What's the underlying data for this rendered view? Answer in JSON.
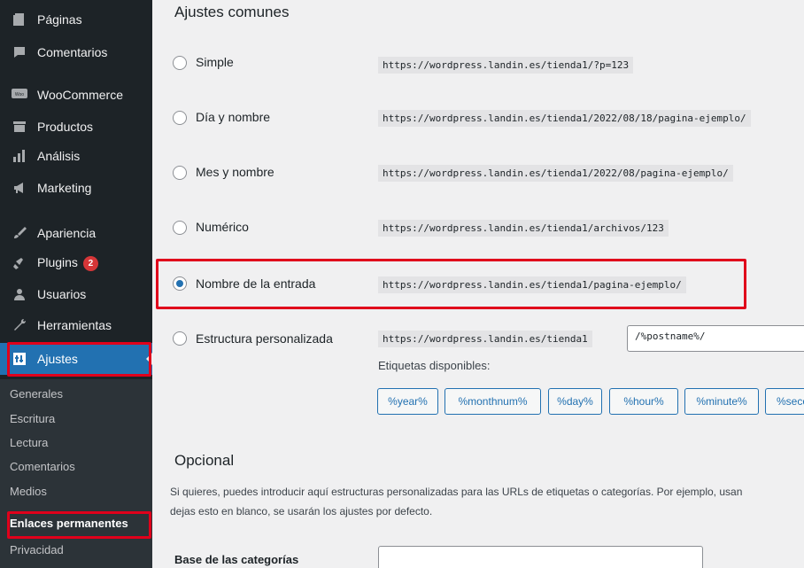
{
  "sidebar": {
    "items": [
      {
        "label": "Páginas",
        "icon": "pages-icon"
      },
      {
        "label": "Comentarios",
        "icon": "comments-icon"
      },
      {
        "label": "WooCommerce",
        "icon": "woocommerce-icon"
      },
      {
        "label": "Productos",
        "icon": "products-icon"
      },
      {
        "label": "Análisis",
        "icon": "analytics-icon"
      },
      {
        "label": "Marketing",
        "icon": "marketing-icon"
      },
      {
        "label": "Apariencia",
        "icon": "appearance-icon"
      },
      {
        "label": "Plugins",
        "icon": "plugins-icon",
        "badge": "2"
      },
      {
        "label": "Usuarios",
        "icon": "users-icon"
      },
      {
        "label": "Herramientas",
        "icon": "tools-icon"
      },
      {
        "label": "Ajustes",
        "icon": "settings-icon",
        "active": true
      }
    ],
    "submenu": [
      {
        "label": "Generales"
      },
      {
        "label": "Escritura"
      },
      {
        "label": "Lectura"
      },
      {
        "label": "Comentarios"
      },
      {
        "label": "Medios"
      },
      {
        "label": "Enlaces permanentes",
        "current": true
      },
      {
        "label": "Privacidad"
      }
    ]
  },
  "main": {
    "common_title": "Ajustes comunes",
    "options": [
      {
        "label": "Simple",
        "url": "https://wordpress.landin.es/tienda1/?p=123",
        "checked": false
      },
      {
        "label": "Día y nombre",
        "url": "https://wordpress.landin.es/tienda1/2022/08/18/pagina-ejemplo/",
        "checked": false
      },
      {
        "label": "Mes y nombre",
        "url": "https://wordpress.landin.es/tienda1/2022/08/pagina-ejemplo/",
        "checked": false
      },
      {
        "label": "Numérico",
        "url": "https://wordpress.landin.es/tienda1/archivos/123",
        "checked": false
      },
      {
        "label": "Nombre de la entrada",
        "url": "https://wordpress.landin.es/tienda1/pagina-ejemplo/",
        "checked": true
      },
      {
        "label": "Estructura personalizada",
        "url": "https://wordpress.landin.es/tienda1",
        "checked": false
      }
    ],
    "custom_structure_value": "/%postname%/",
    "tags_label": "Etiquetas disponibles:",
    "tags": [
      "%year%",
      "%monthnum%",
      "%day%",
      "%hour%",
      "%minute%",
      "%seco"
    ],
    "optional_title": "Opcional",
    "optional_desc_line1": "Si quieres, puedes introducir aquí estructuras personalizadas para las URLs de etiquetas o categorías. Por ejemplo, usan",
    "optional_desc_line2": "dejas esto en blanco, se usarán los ajustes por defecto.",
    "category_base_label": "Base de las categorías",
    "category_base_value": ""
  },
  "colors": {
    "sidebar_bg": "#1d2327",
    "submenu_bg": "#2c3338",
    "accent": "#2271b1",
    "badge": "#d63638",
    "highlight": "#e0001b"
  }
}
